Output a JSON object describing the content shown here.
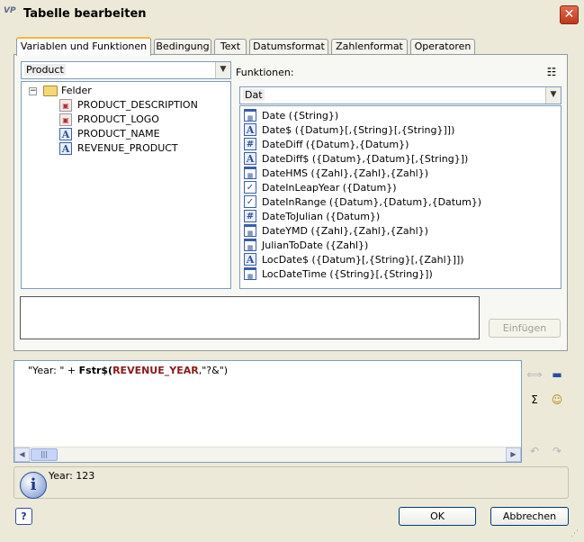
{
  "window": {
    "title": "Tabelle bearbeiten",
    "app_badge": "VP",
    "close_glyph": "✕"
  },
  "tabs": [
    {
      "label": "Variablen und Funktionen",
      "active": true
    },
    {
      "label": "Bedingung"
    },
    {
      "label": "Text"
    },
    {
      "label": "Datumsformat"
    },
    {
      "label": "Zahlenformat"
    },
    {
      "label": "Operatoren"
    }
  ],
  "variables": {
    "source_selected": "Product",
    "tree": {
      "root_label": "Felder",
      "items": [
        {
          "label": "PRODUCT_DESCRIPTION",
          "icon": "image-field-icon"
        },
        {
          "label": "PRODUCT_LOGO",
          "icon": "image-field-icon"
        },
        {
          "label": "PRODUCT_NAME",
          "icon": "text-field-icon"
        },
        {
          "label": "REVENUE_PRODUCT",
          "icon": "text-field-icon"
        }
      ]
    }
  },
  "functions": {
    "label": "Funktionen:",
    "category_selected": "Dat",
    "items": [
      {
        "label": "Date ({String})",
        "icon": "calendar-icon"
      },
      {
        "label": "Date$ ({Datum}[,{String}[,{String}]])",
        "icon": "text-type-icon"
      },
      {
        "label": "DateDiff ({Datum},{Datum})",
        "icon": "number-type-icon"
      },
      {
        "label": "DateDiff$ ({Datum},{Datum}[,{String}])",
        "icon": "text-type-icon"
      },
      {
        "label": "DateHMS ({Zahl},{Zahl},{Zahl})",
        "icon": "calendar-icon"
      },
      {
        "label": "DateInLeapYear ({Datum})",
        "icon": "boolean-type-icon"
      },
      {
        "label": "DateInRange ({Datum},{Datum},{Datum})",
        "icon": "boolean-type-icon"
      },
      {
        "label": "DateToJulian ({Datum})",
        "icon": "number-type-icon"
      },
      {
        "label": "DateYMD ({Zahl},{Zahl},{Zahl})",
        "icon": "calendar-icon"
      },
      {
        "label": "JulianToDate ({Zahl})",
        "icon": "calendar-icon"
      },
      {
        "label": "LocDate$ ({Datum}[,{String}[,{Zahl}]])",
        "icon": "text-type-icon"
      },
      {
        "label": "LocDateTime ({String}[,{String}])",
        "icon": "calendar-icon"
      }
    ]
  },
  "insert_button": {
    "label": "Einfügen",
    "enabled": false
  },
  "editor": {
    "part1": "\"Year: \" + ",
    "part2": "Fstr$(",
    "part3": "REVENUE_YEAR",
    "part4": ",\"?&\")"
  },
  "info": {
    "text": "Year: 123"
  },
  "buttons": {
    "ok": "OK",
    "cancel": "Abbrechen",
    "help": "?"
  },
  "colors": {
    "active_tab_accent": "#f9b33f",
    "border_blue": "#7f9db9",
    "close_red": "#c1371b"
  }
}
